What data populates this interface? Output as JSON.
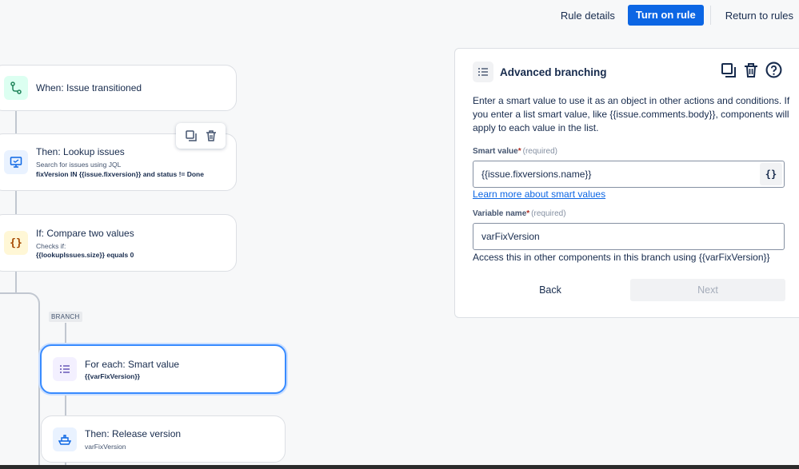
{
  "topbar": {
    "rule_details": "Rule details",
    "turn_on": "Turn on rule",
    "return": "Return to rules"
  },
  "flow": {
    "trigger": {
      "title": "When: Issue transitioned",
      "icon": "transition-icon"
    },
    "lookup": {
      "title": "Then: Lookup issues",
      "subtitle": "Search for issues using JQL",
      "detail": "fixVersion IN {{issue.fixversion}} and status != Done",
      "icon": "lookup-issues-icon"
    },
    "compare": {
      "title": "If: Compare two values",
      "subtitle": "Checks if:",
      "detail": "{{lookupIssues.size}} equals 0",
      "icon": "braces-icon"
    },
    "branch_label": "BRANCH",
    "foreach": {
      "title": "For each: Smart value",
      "detail": "{{varFixVersion}}",
      "icon": "list-icon"
    },
    "release": {
      "title": "Then: Release version",
      "detail": "varFixVersion",
      "icon": "ship-icon"
    }
  },
  "panel": {
    "title": "Advanced branching",
    "description": "Enter a smart value to use it as an object in other actions and conditions. If you enter a list smart value, like {{issue.comments.body}}, components will apply to each value in the list.",
    "smart_value_label": "Smart value",
    "required_marker": "*",
    "required_text": "(required)",
    "smart_value": "{{issue.fixversions.name}}",
    "brace_button": "{}",
    "learn_more": "Learn more about smart values",
    "variable_label": "Variable name",
    "variable_value": "varFixVersion",
    "help_text": "Access this in other components in this branch using {{varFixVersion}}",
    "back": "Back",
    "next": "Next"
  },
  "colors": {
    "primary": "#0c66e4",
    "trigger_icon_bg": "#dcfff1",
    "action_icon_bg": "#e9f2ff",
    "condition_icon_bg": "#fff7d6",
    "branch_icon_bg": "#f3f0ff",
    "selected_border": "#388bff"
  }
}
